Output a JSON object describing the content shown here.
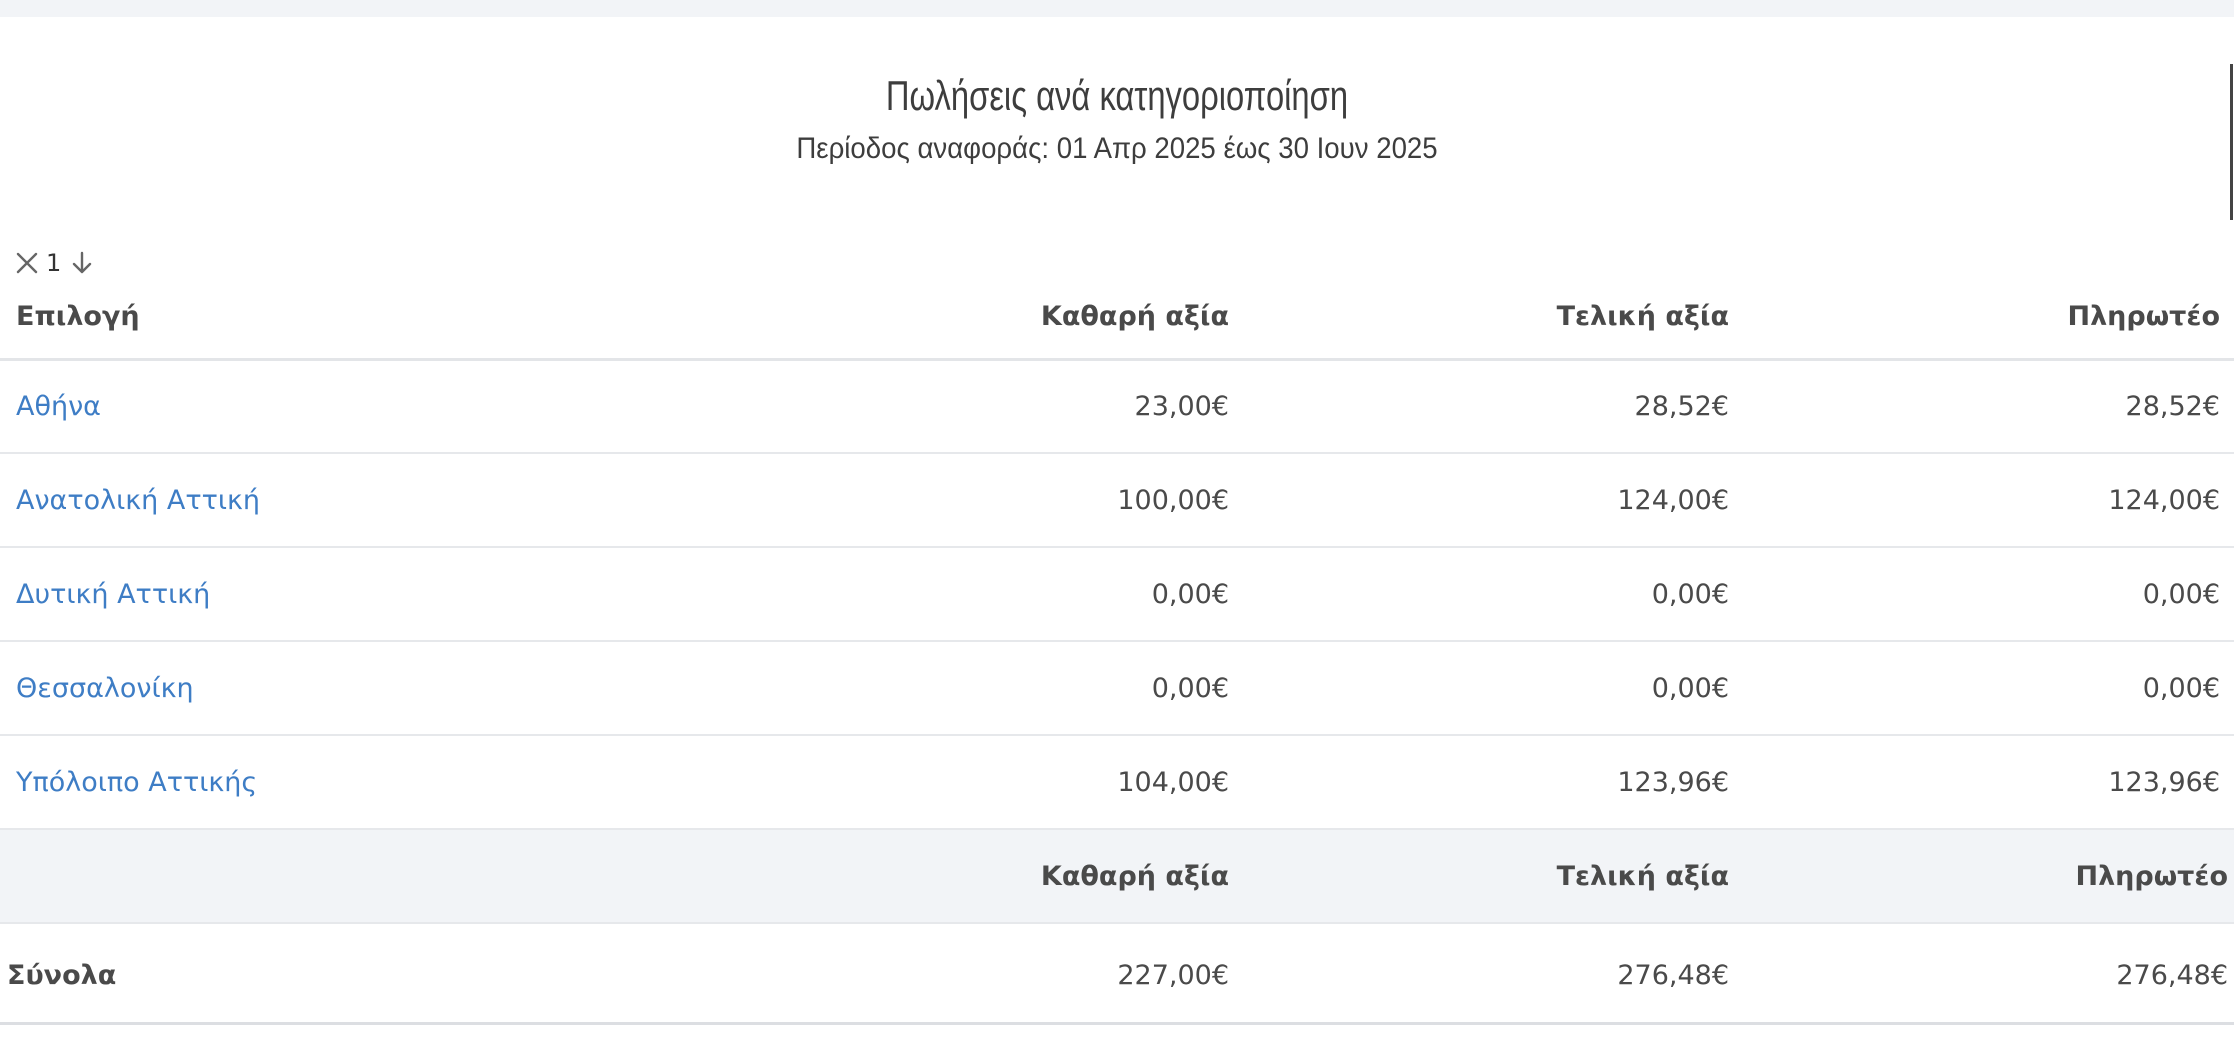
{
  "report": {
    "title": "Πωλήσεις ανά κατηγοριοποίηση",
    "period": "Περίοδος αναφοράς: 01 Απρ 2025 έως 30 Ιουν 2025"
  },
  "sort": {
    "count": "1",
    "clear_icon": "close-icon",
    "direction_icon": "arrow-down-icon"
  },
  "table": {
    "headers": {
      "option": "Επιλογή",
      "net": "Καθαρή αξία",
      "final": "Τελική αξία",
      "payable": "Πληρωτέο"
    },
    "rows": [
      {
        "name": "Αθήνα",
        "net": "23,00€",
        "final": "28,52€",
        "payable": "28,52€"
      },
      {
        "name": "Ανατολική Αττική",
        "net": "100,00€",
        "final": "124,00€",
        "payable": "124,00€"
      },
      {
        "name": "Δυτική Αττική",
        "net": "0,00€",
        "final": "0,00€",
        "payable": "0,00€"
      },
      {
        "name": "Θεσσαλονίκη",
        "net": "0,00€",
        "final": "0,00€",
        "payable": "0,00€"
      },
      {
        "name": "Υπόλοιπο Αττικής",
        "net": "104,00€",
        "final": "123,96€",
        "payable": "123,96€"
      }
    ],
    "totals_headers": {
      "net": "Καθαρή αξία",
      "final": "Τελική αξία",
      "payable": "Πληρωτέο"
    },
    "totals": {
      "label": "Σύνολα",
      "net": "227,00€",
      "final": "276,48€",
      "payable": "276,48€"
    }
  },
  "colors": {
    "link": "#3e7dc5",
    "band": "#f2f4f7",
    "text": "#444444"
  }
}
